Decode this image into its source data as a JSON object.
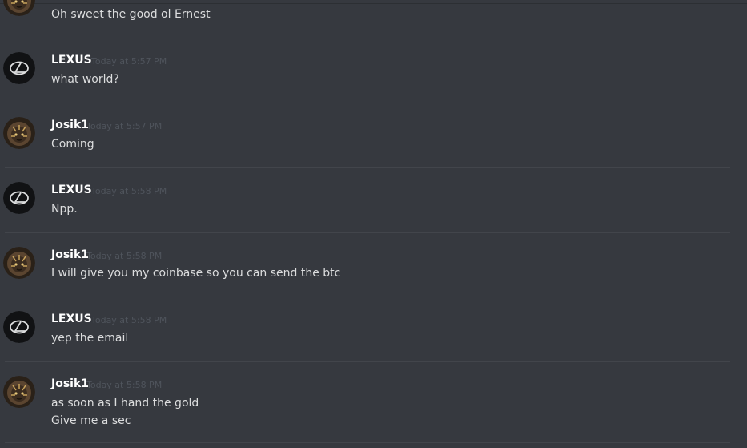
{
  "colors": {
    "background": "#36393f",
    "author": "#ffffff",
    "text": "#dcddde",
    "timestamp": "#4f545c",
    "divider": "#42454b"
  },
  "messages": [
    {
      "author": "",
      "avatar": "lion-avatar-icon",
      "time": "",
      "lines": [
        "Oh sweet the good ol Ernest"
      ]
    },
    {
      "author": "LEXUS",
      "avatar": "lexus-logo-icon",
      "time": "Today at 5:57 PM",
      "lines": [
        "what world?"
      ]
    },
    {
      "author": "Josik1",
      "avatar": "lion-avatar-icon",
      "time": "Today at 5:57 PM",
      "lines": [
        "Coming"
      ]
    },
    {
      "author": "LEXUS",
      "avatar": "lexus-logo-icon",
      "time": "Today at 5:58 PM",
      "lines": [
        "Npp."
      ]
    },
    {
      "author": "Josik1",
      "avatar": "lion-avatar-icon",
      "time": "Today at 5:58 PM",
      "lines": [
        "I will give you my coinbase so you can send the btc"
      ]
    },
    {
      "author": "LEXUS",
      "avatar": "lexus-logo-icon",
      "time": "Today at 5:58 PM",
      "lines": [
        "yep the email"
      ]
    },
    {
      "author": "Josik1",
      "avatar": "lion-avatar-icon",
      "time": "Today at 5:58 PM",
      "lines": [
        "as soon as I hand the gold",
        "Give me a sec"
      ]
    }
  ]
}
